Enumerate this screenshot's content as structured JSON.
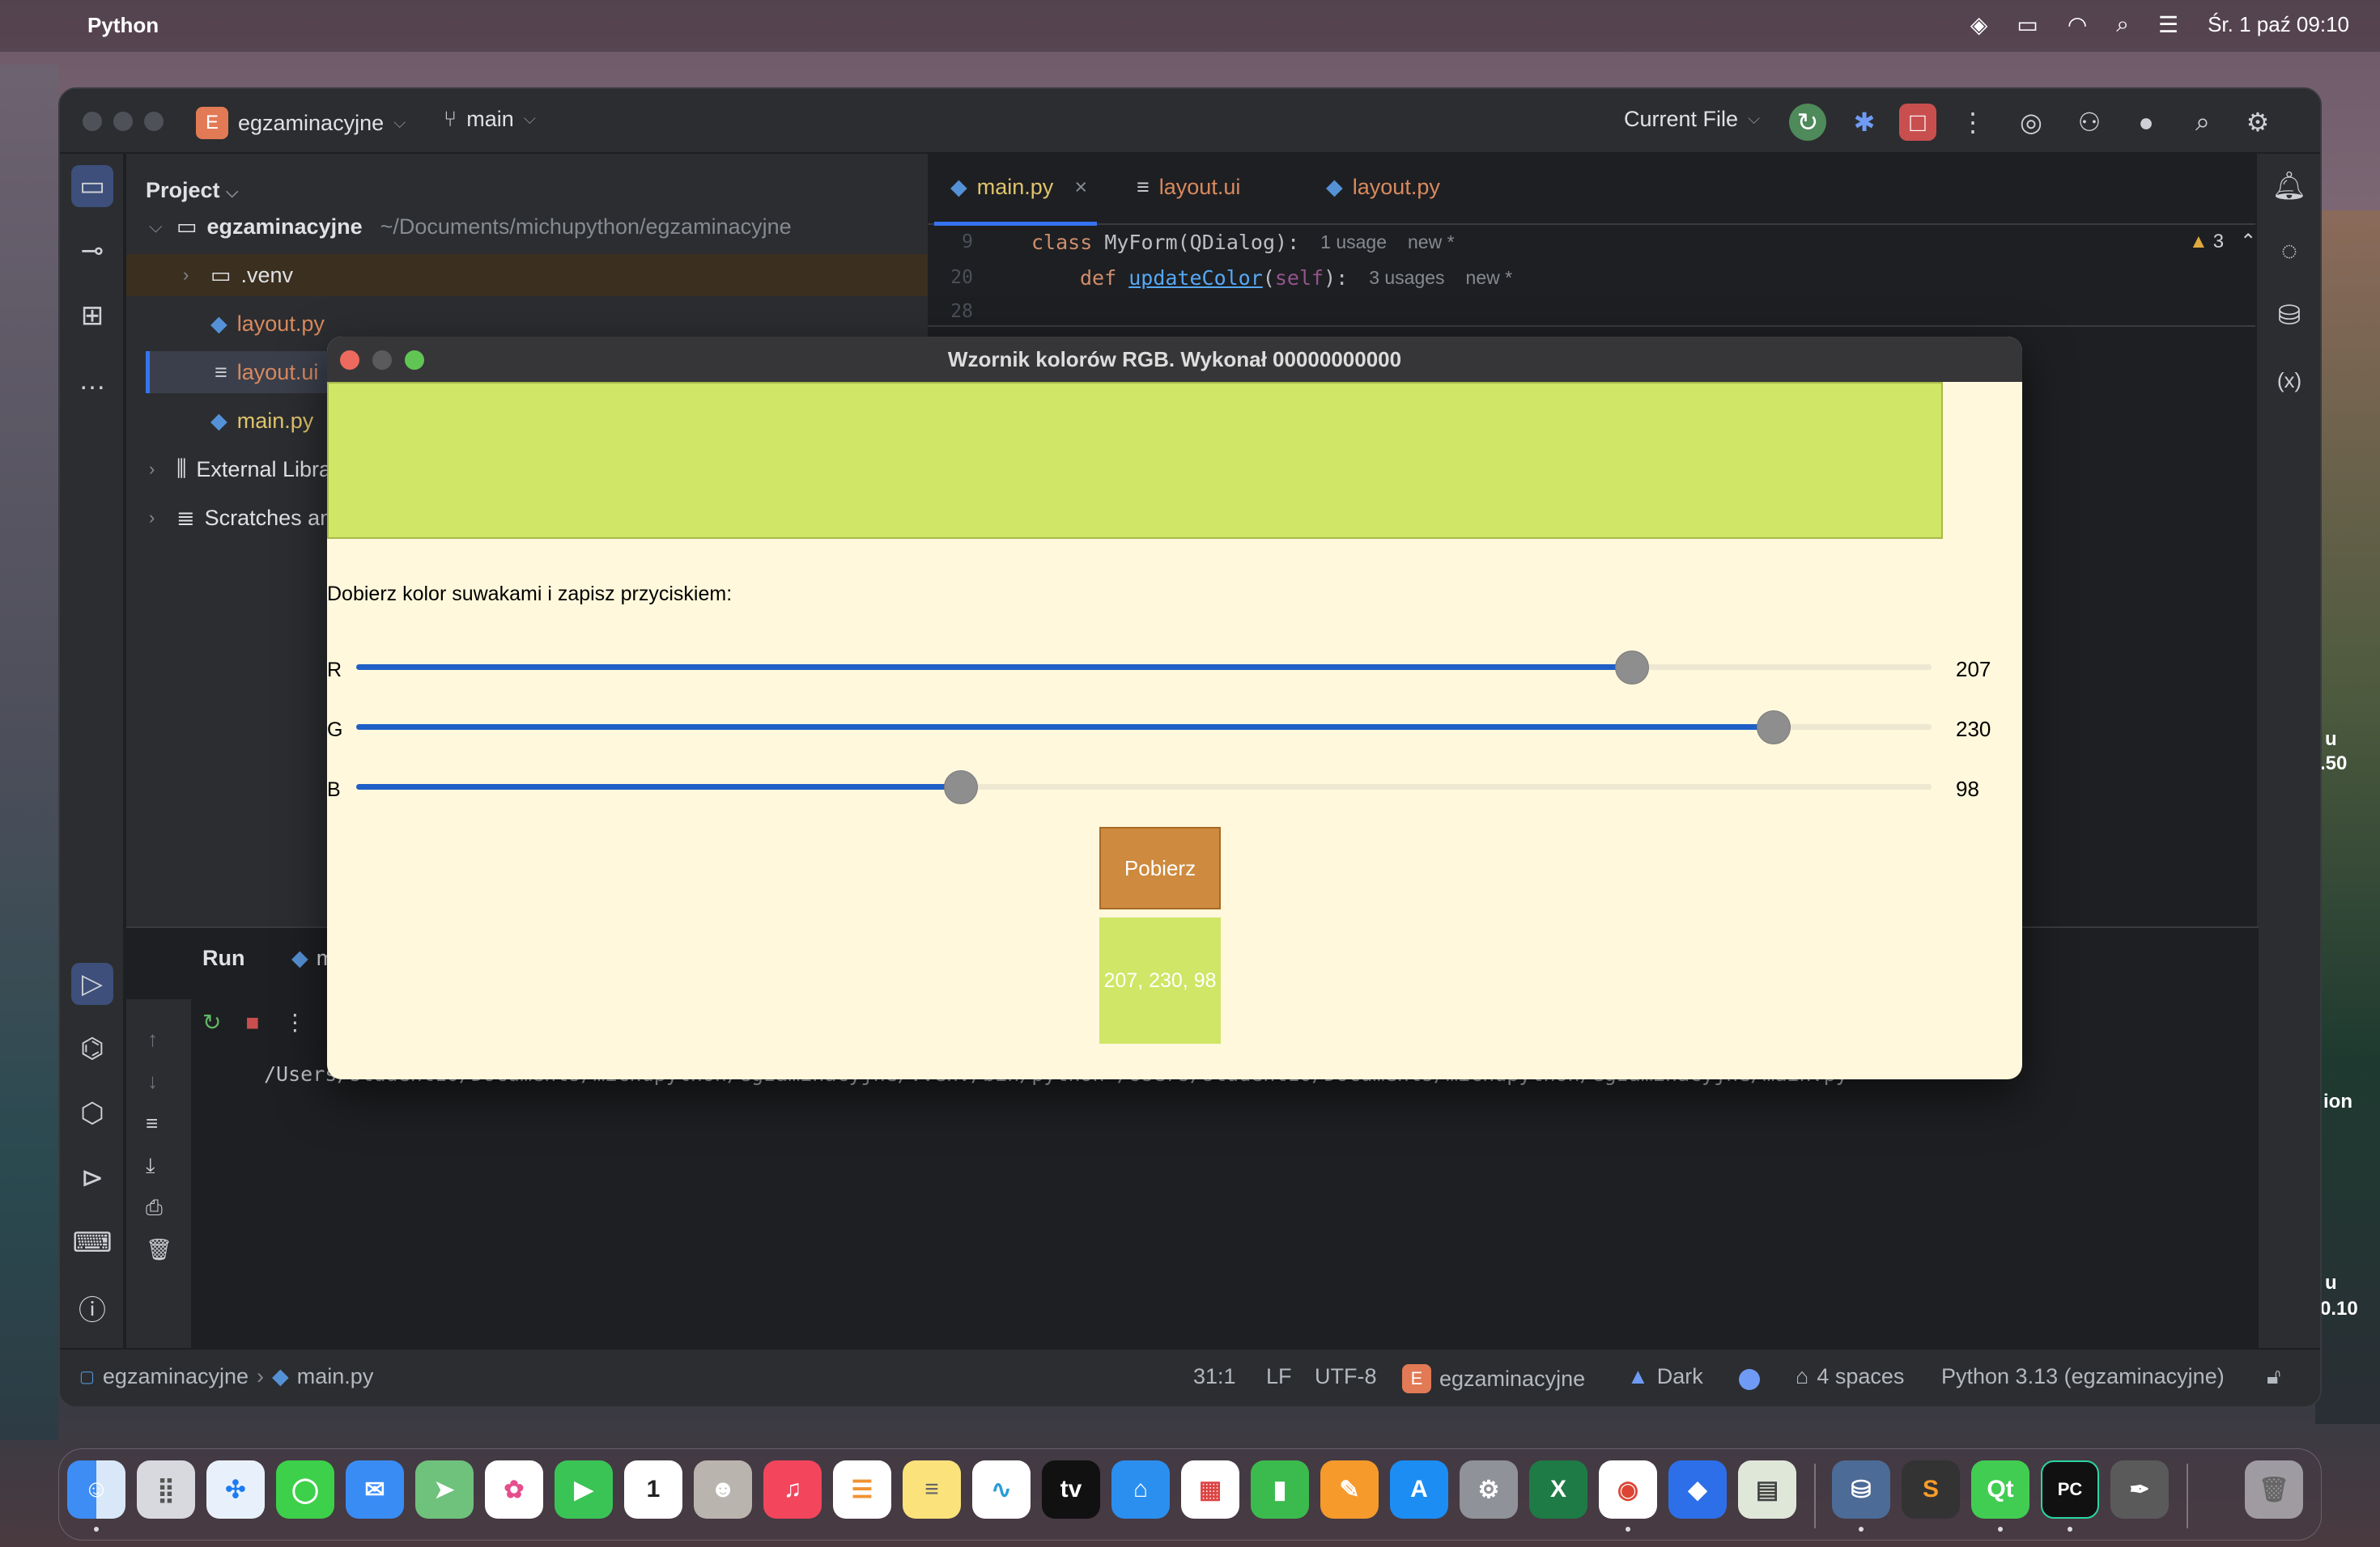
{
  "menubar": {
    "app_name": "Python",
    "datetime": "Śr. 1 paź  09:10"
  },
  "ide": {
    "project_badge": "E",
    "project_name": "egzaminacyjne",
    "branch": "main",
    "run_config": "Current File",
    "project_panel": {
      "title": "Project",
      "root_name": "egzaminacyjne",
      "root_path": "~/Documents/michupython/egzaminacyjne",
      "items": [
        {
          "label": ".venv"
        },
        {
          "label": "layout.py"
        },
        {
          "label": "layout.ui"
        },
        {
          "label": "main.py"
        },
        {
          "label": "External Libraries"
        },
        {
          "label": "Scratches and Consoles"
        }
      ]
    },
    "tabs": [
      {
        "label": "main.py"
      },
      {
        "label": "layout.ui"
      },
      {
        "label": "layout.py"
      }
    ],
    "code": [
      {
        "ln": "9",
        "kw": "class ",
        "name": "MyForm(QDialog):",
        "hint1": "1 usage",
        "hint2": "new *"
      },
      {
        "ln": "20",
        "kw": "def ",
        "fn": "updateColor",
        "open": "(",
        "self": "self",
        "close": "):",
        "hint1": "3 usages",
        "hint2": "new *"
      },
      {
        "ln": "28"
      }
    ],
    "warnings": "3",
    "run": {
      "title": "Run",
      "config": "main",
      "output": "/Users/student10/Documents/michupython/egzaminacyjne/.venv/bin/python /Users/student10/Documents/michupython/egzaminacyjne/main.py"
    },
    "statusbar": {
      "crumb_project": "egzaminacyjne",
      "crumb_file": "main.py",
      "position": "31:1",
      "line_sep": "LF",
      "encoding": "UTF-8",
      "badge": "E",
      "project": "egzaminacyjne",
      "theme": "Dark",
      "indent": "4 spaces",
      "interpreter": "Python 3.13 (egzaminacyjne)"
    }
  },
  "dialog": {
    "title": "Wzornik kolorów RGB. Wykonał 00000000000",
    "prompt": "Dobierz kolor suwakami i zapisz przyciskiem:",
    "preview_color": "#cfe666",
    "sliders": [
      {
        "label": "R",
        "value": "207",
        "fraction": 0.81
      },
      {
        "label": "G",
        "value": "230",
        "fraction": 0.9
      },
      {
        "label": "B",
        "value": "98",
        "fraction": 0.384
      }
    ],
    "button_label": "Pobierz",
    "result_text": "207, 230, 98",
    "result_color": "#cfe666"
  },
  "background_fragments": [
    "u",
    ".50",
    "ion",
    "u",
    "0.10"
  ],
  "colors": {
    "accent": "#3574f0",
    "slider": "#1f5fc7",
    "button": "#ce8a3e",
    "dialog_bg": "#fff8dc"
  }
}
